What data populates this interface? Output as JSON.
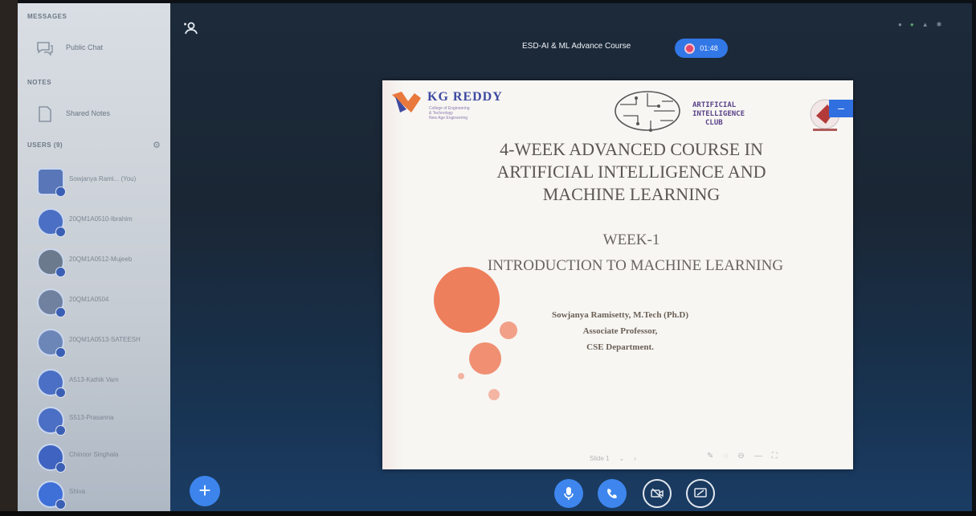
{
  "sidebar": {
    "messages_label": "MESSAGES",
    "public_chat": "Public Chat",
    "notes_label": "NOTES",
    "shared_notes": "Shared Notes",
    "users_label": "USERS (9)",
    "users": [
      {
        "name": "Sowjanya Rami... (You)"
      },
      {
        "name": "20QM1A0510-Ibrahim"
      },
      {
        "name": "20QM1A0512-Mujeeb"
      },
      {
        "name": "20QM1A0504"
      },
      {
        "name": "20QM1A0513-SATEESH"
      },
      {
        "name": "A513-Kathik Vam"
      },
      {
        "name": "S513-Prasanna"
      },
      {
        "name": "Chinoor Singhala"
      },
      {
        "name": "Shiva"
      }
    ]
  },
  "header": {
    "meeting_title": "ESD-AI & ML Advance Course",
    "recording_time": "01:48"
  },
  "slide": {
    "kg_title": "KG REDDY",
    "kg_sub": "College of Engineering\n& Technology\nNew Age Engineering",
    "ai_club": [
      "ARTIFICIAL",
      "INTELLIGENCE",
      "CLUB"
    ],
    "title_lines": [
      "4-WEEK ADVANCED COURSE IN",
      "ARTIFICIAL INTELLIGENCE AND",
      "MACHINE LEARNING"
    ],
    "week": "WEEK-1",
    "subtitle": "INTRODUCTION TO MACHINE LEARNING",
    "presenter": "Sowjanya Ramisetty, M.Tech (Ph.D)",
    "designation": "Associate Professor,",
    "department": "CSE Department.",
    "slide_selector": "Slide 1"
  },
  "colors": {
    "accent": "#3e86ee",
    "record_dot": "#e4466a",
    "circle_orange": "#ee7f5c"
  },
  "icons": {
    "participants": "participants-icon",
    "chat": "chat-icon",
    "notes": "notes-icon",
    "gear": "gear-icon",
    "mic": "microphone-icon",
    "phone": "phone-icon",
    "camera": "camera-off-icon",
    "screen": "screen-share-icon",
    "plus": "plus-icon"
  }
}
